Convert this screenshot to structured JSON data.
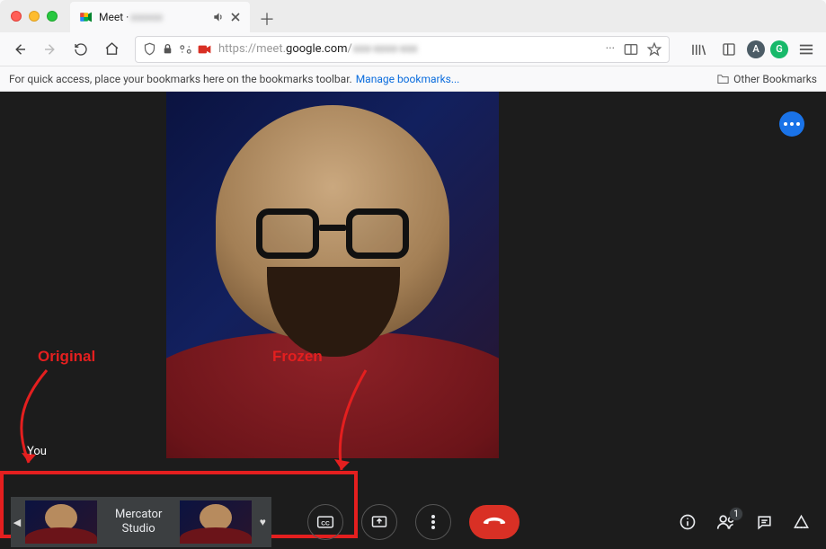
{
  "tab": {
    "title_prefix": "Meet ·",
    "blurred_suffix": "xxxxxx"
  },
  "url": {
    "protocol": "https://",
    "sub": "meet.",
    "host": "google.com",
    "path_visible": "/",
    "path_blurred": "xxx-xxxx-xxx"
  },
  "bookmarks_hint": "For quick access, place your bookmarks here on the bookmarks toolbar.",
  "bookmarks_link": "Manage bookmarks...",
  "other_bookmarks": "Other Bookmarks",
  "you_label": "You",
  "filmstrip_label": "Mercator\nStudio",
  "people_count": "1",
  "annotations": {
    "original": "Original",
    "frozen": "Frozen"
  },
  "toolbar_badges": {
    "a": "A",
    "g": "G"
  }
}
